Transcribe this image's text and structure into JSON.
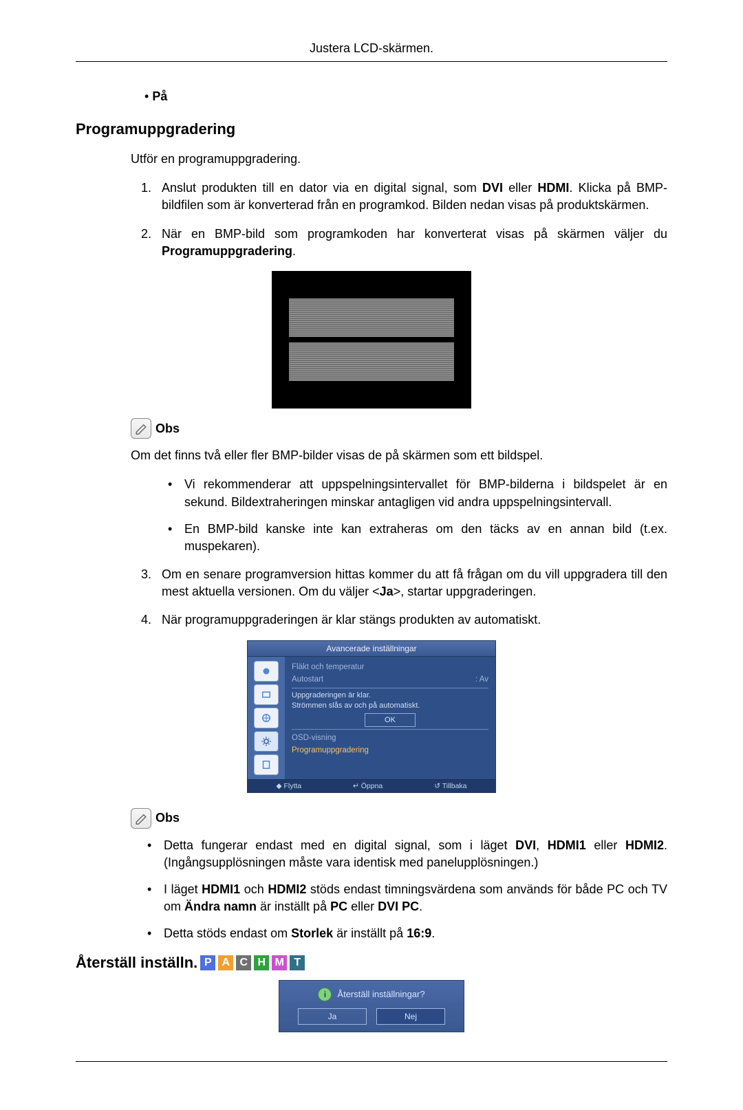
{
  "header": "Justera LCD-skärmen.",
  "top_bullet": "På",
  "sections": {
    "upgrade_heading": "Programuppgradering",
    "upgrade_intro": "Utför en programuppgradering.",
    "list1": {
      "i1_pre": "Anslut produkten till en dator via en digital signal, som ",
      "i1_dvi": "DVI",
      "i1_mid1": " eller ",
      "i1_hdmi": "HDMI",
      "i1_post": ". Klicka på BMP-bildfilen som är konverterad från en programkod. Bilden nedan visas på produktskärmen.",
      "i2_pre": "När en BMP-bild som programkoden har konverterat visas på skärmen väljer du ",
      "i2_bold": "Programuppgradering",
      "i2_post": "."
    },
    "note1_label": "Obs",
    "note1_para": "Om det finns två eller fler BMP-bilder visas de på skärmen som ett bildspel.",
    "note1_sub": {
      "a": "Vi rekommenderar att uppspelningsintervallet för BMP-bilderna i bildspelet är en sekund. Bildextraheringen minskar antagligen vid andra uppspelningsintervall.",
      "b": "En BMP-bild kanske inte kan extraheras om den täcks av en annan bild (t.ex. muspekaren)."
    },
    "list2": {
      "i3_pre": "Om en senare programversion hittas kommer du att få frågan om du vill uppgradera till den mest aktuella versionen. Om du väljer <",
      "i3_bold": "Ja",
      "i3_post": ">, startar uppgraderingen.",
      "i4": "När programuppgraderingen är klar stängs produkten av automatiskt."
    },
    "note2_label": "Obs",
    "note2_sub": {
      "a_pre": "Detta fungerar endast med en digital signal, som i läget ",
      "a_dvi": "DVI",
      "a_mid1": ", ",
      "a_h1": "HDMI1",
      "a_mid2": " eller ",
      "a_h2": "HDMI2",
      "a_post": ". (Ingångsupplösningen måste vara identisk med panelupplösningen.)",
      "b_pre": "I läget ",
      "b_h1": "HDMI1",
      "b_mid1": " och ",
      "b_h2": "HDMI2",
      "b_mid2": " stöds endast timningsvärdena som används för både PC och TV om ",
      "b_en": "Ändra namn",
      "b_mid3": " är inställt på ",
      "b_pc": "PC",
      "b_mid4": " eller ",
      "b_dp": "DVI PC",
      "b_post": ".",
      "c_pre": "Detta stöds endast om ",
      "c_b": "Storlek",
      "c_mid": " är inställt på ",
      "c_v": "16:9",
      "c_post": "."
    },
    "reset_heading": "Återställ inställn."
  },
  "badges": {
    "p": "P",
    "a": "A",
    "c": "C",
    "h": "H",
    "m": "M",
    "t": "T"
  },
  "osd": {
    "title": "Avancerade inställningar",
    "row1": "Fläkt och temperatur",
    "row2_l": "Autostart",
    "row2_r": ": Av",
    "msg1": "Uppgraderingen är klar.",
    "msg2": "Strömmen slås av och på automatiskt.",
    "ok": "OK",
    "row3": "OSD-visning",
    "row4": "Programuppgradering",
    "foot1": "Flytta",
    "foot2": "Öppna",
    "foot3": "Tillbaka"
  },
  "dialog": {
    "question": "Återställ inställningar?",
    "yes": "Ja",
    "no": "Nej"
  }
}
